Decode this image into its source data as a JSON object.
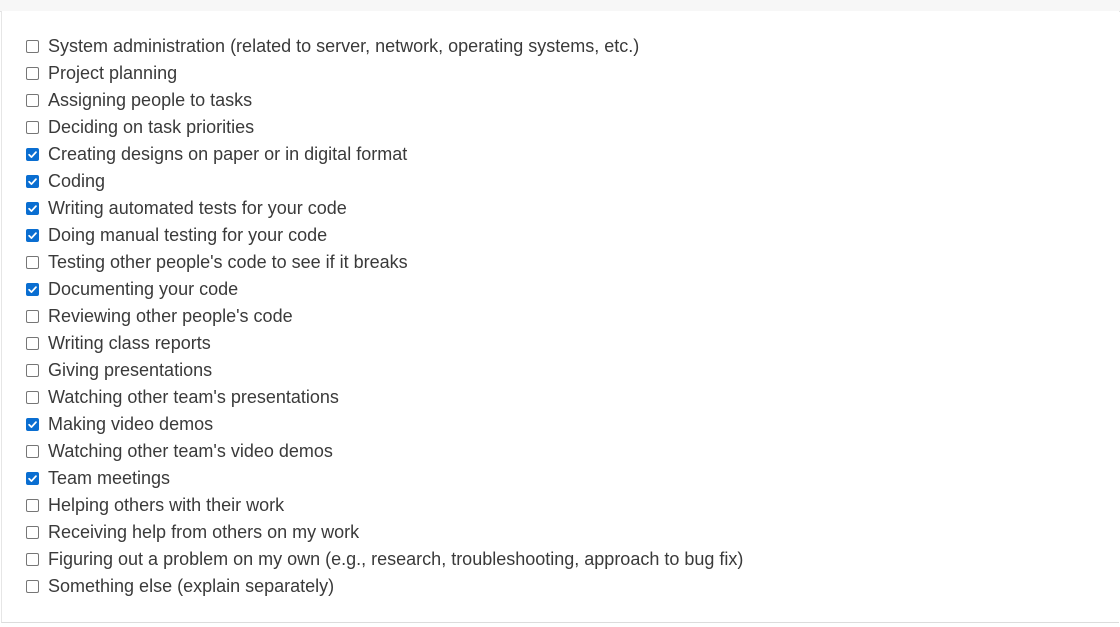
{
  "options": [
    {
      "label": "System administration (related to server, network, operating systems, etc.)",
      "checked": false
    },
    {
      "label": "Project planning",
      "checked": false
    },
    {
      "label": "Assigning people to tasks",
      "checked": false
    },
    {
      "label": "Deciding on task priorities",
      "checked": false
    },
    {
      "label": "Creating designs on paper or in digital format",
      "checked": true
    },
    {
      "label": "Coding",
      "checked": true
    },
    {
      "label": "Writing automated tests for your code",
      "checked": true
    },
    {
      "label": "Doing manual testing for your code",
      "checked": true
    },
    {
      "label": "Testing other people's code to see if it breaks",
      "checked": false
    },
    {
      "label": "Documenting your code",
      "checked": true
    },
    {
      "label": "Reviewing other people's code",
      "checked": false
    },
    {
      "label": "Writing class reports",
      "checked": false
    },
    {
      "label": "Giving presentations",
      "checked": false
    },
    {
      "label": "Watching other team's presentations",
      "checked": false
    },
    {
      "label": "Making video demos",
      "checked": true
    },
    {
      "label": "Watching other team's video demos",
      "checked": false
    },
    {
      "label": "Team meetings",
      "checked": true
    },
    {
      "label": "Helping others with their work",
      "checked": false
    },
    {
      "label": "Receiving help from others on my work",
      "checked": false
    },
    {
      "label": "Figuring out a problem on my own (e.g., research, troubleshooting, approach to bug fix)",
      "checked": false
    },
    {
      "label": "Something else (explain separately)",
      "checked": false
    }
  ],
  "colors": {
    "checked_fill": "#0a6ed1",
    "label_text": "#3a3a3a"
  }
}
